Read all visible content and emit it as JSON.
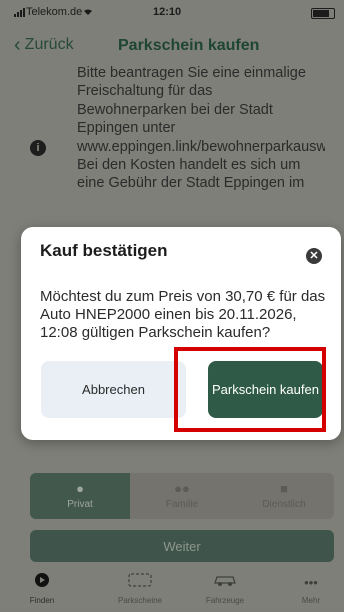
{
  "status_bar": {
    "carrier": "Telekom.de",
    "time": "12:10"
  },
  "header": {
    "back_label": "Zurück",
    "title": "Parkschein kaufen"
  },
  "info": {
    "text": "Bitte beantragen Sie eine einmalige Freischaltung für das Bewohnerparken bei der Stadt Eppingen unter www.eppingen.link/bewohnerparkausweis. Bei den Kosten handelt es sich um eine Gebühr der Stadt Eppingen im"
  },
  "modal": {
    "title": "Kauf bestätigen",
    "message": "Möchtest du zum Preis von 30,70 € für das Auto HNEP2000 einen bis 20.11.2026, 12:08 gültigen Parkschein kaufen?",
    "cancel_label": "Abbrechen",
    "confirm_label": "Parkschein kaufen"
  },
  "tabs": [
    {
      "label": "Privat",
      "icon": "person-icon",
      "active": true
    },
    {
      "label": "Familie",
      "icon": "family-icon",
      "active": false
    },
    {
      "label": "Dienstlich",
      "icon": "briefcase-icon",
      "active": false
    }
  ],
  "weiter_label": "Weiter",
  "bottom_nav": [
    {
      "label": "Finden",
      "icon": "location-icon",
      "active": true
    },
    {
      "label": "Parkscheine",
      "icon": "ticket-icon",
      "active": false
    },
    {
      "label": "Fahrzeuge",
      "icon": "car-icon",
      "active": false
    },
    {
      "label": "Mehr",
      "icon": "more-icon",
      "active": false
    }
  ],
  "colors": {
    "brand_green": "#2f5a47",
    "highlight_red": "#d40000",
    "overlay": "#7f7f79"
  }
}
